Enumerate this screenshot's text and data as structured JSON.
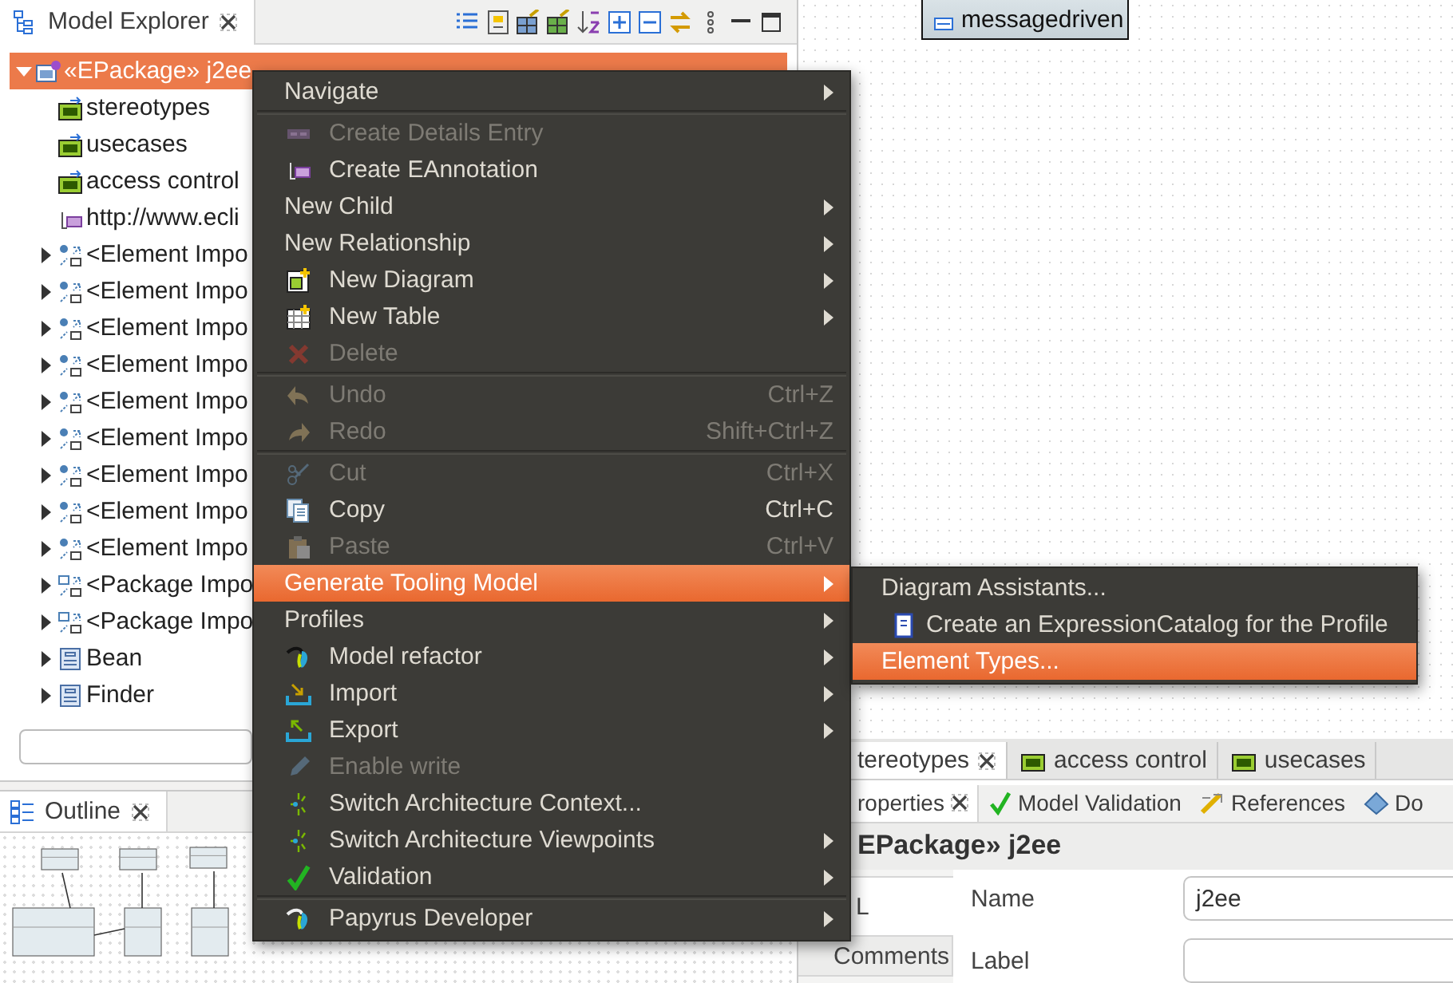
{
  "model_explorer": {
    "title": "Model Explorer",
    "tree": [
      {
        "label": "«EPackage» j2ee",
        "kind": "package",
        "expanded": true,
        "selected": true,
        "children": [
          {
            "label": "stereotypes",
            "kind": "profile",
            "selected": false
          },
          {
            "label": "usecases",
            "kind": "profile",
            "selected": false
          },
          {
            "label": "access control",
            "kind": "profile",
            "selected": false
          },
          {
            "label": "http://www.ecli",
            "kind": "annotation",
            "selected": false
          },
          {
            "label": "<Element Impo",
            "kind": "element-import",
            "expanded": false,
            "selected": false
          },
          {
            "label": "<Element Impo",
            "kind": "element-import",
            "expanded": false,
            "selected": false
          },
          {
            "label": "<Element Impo",
            "kind": "element-import",
            "expanded": false,
            "selected": false
          },
          {
            "label": "<Element Impo",
            "kind": "element-import",
            "expanded": false,
            "selected": false
          },
          {
            "label": "<Element Impo",
            "kind": "element-import",
            "expanded": false,
            "selected": false
          },
          {
            "label": "<Element Impo",
            "kind": "element-import",
            "expanded": false,
            "selected": false
          },
          {
            "label": "<Element Impo",
            "kind": "element-import",
            "expanded": false,
            "selected": false
          },
          {
            "label": "<Element Impo",
            "kind": "element-import",
            "expanded": false,
            "selected": false
          },
          {
            "label": "<Element Impo",
            "kind": "element-import",
            "expanded": false,
            "selected": false
          },
          {
            "label": "<Package Impo",
            "kind": "package-import",
            "expanded": false,
            "selected": false
          },
          {
            "label": "<Package Impo",
            "kind": "package-import",
            "expanded": false,
            "selected": false
          },
          {
            "label": "Bean",
            "kind": "stereotype",
            "expanded": false,
            "selected": false
          },
          {
            "label": "Finder",
            "kind": "stereotype",
            "expanded": false,
            "selected": false
          }
        ]
      }
    ]
  },
  "outline": {
    "title": "Outline"
  },
  "diagram": {
    "nodes": [
      {
        "label": "messagedriven"
      }
    ]
  },
  "context_menu": {
    "items": [
      {
        "kind": "item",
        "label": "Navigate",
        "submenu": true,
        "disabled": false,
        "selected": false
      },
      {
        "kind": "separator"
      },
      {
        "kind": "item",
        "label": "Create Details Entry",
        "submenu": false,
        "disabled": true,
        "selected": false
      },
      {
        "kind": "item",
        "label": "Create EAnnotation",
        "submenu": false,
        "disabled": false,
        "selected": false
      },
      {
        "kind": "item",
        "label": "New Child",
        "submenu": true,
        "disabled": false,
        "selected": false
      },
      {
        "kind": "item",
        "label": "New Relationship",
        "submenu": true,
        "disabled": false,
        "selected": false
      },
      {
        "kind": "item",
        "label": "New Diagram",
        "submenu": true,
        "disabled": false,
        "selected": false
      },
      {
        "kind": "item",
        "label": "New Table",
        "submenu": true,
        "disabled": false,
        "selected": false
      },
      {
        "kind": "item",
        "label": "Delete",
        "submenu": false,
        "disabled": true,
        "selected": false
      },
      {
        "kind": "separator"
      },
      {
        "kind": "item",
        "label": "Undo",
        "shortcut": "Ctrl+Z",
        "submenu": false,
        "disabled": true,
        "selected": false
      },
      {
        "kind": "item",
        "label": "Redo",
        "shortcut": "Shift+Ctrl+Z",
        "submenu": false,
        "disabled": true,
        "selected": false
      },
      {
        "kind": "separator"
      },
      {
        "kind": "item",
        "label": "Cut",
        "shortcut": "Ctrl+X",
        "submenu": false,
        "disabled": true,
        "selected": false
      },
      {
        "kind": "item",
        "label": "Copy",
        "shortcut": "Ctrl+C",
        "submenu": false,
        "disabled": false,
        "selected": false
      },
      {
        "kind": "item",
        "label": "Paste",
        "shortcut": "Ctrl+V",
        "submenu": false,
        "disabled": true,
        "selected": false
      },
      {
        "kind": "item",
        "label": "Generate Tooling Model",
        "submenu": true,
        "disabled": false,
        "selected": true
      },
      {
        "kind": "item",
        "label": "Profiles",
        "submenu": true,
        "disabled": false,
        "selected": false
      },
      {
        "kind": "item",
        "label": "Model refactor",
        "submenu": true,
        "disabled": false,
        "selected": false
      },
      {
        "kind": "item",
        "label": "Import",
        "submenu": true,
        "disabled": false,
        "selected": false
      },
      {
        "kind": "item",
        "label": "Export",
        "submenu": true,
        "disabled": false,
        "selected": false
      },
      {
        "kind": "item",
        "label": "Enable write",
        "submenu": false,
        "disabled": true,
        "selected": false
      },
      {
        "kind": "item",
        "label": "Switch Architecture Context...",
        "submenu": false,
        "disabled": false,
        "selected": false
      },
      {
        "kind": "item",
        "label": "Switch Architecture Viewpoints",
        "submenu": true,
        "disabled": false,
        "selected": false
      },
      {
        "kind": "item",
        "label": "Validation",
        "submenu": true,
        "disabled": false,
        "selected": false
      },
      {
        "kind": "separator"
      },
      {
        "kind": "item",
        "label": "Papyrus Developer",
        "submenu": true,
        "disabled": false,
        "selected": false
      }
    ]
  },
  "submenu": {
    "items": [
      {
        "label": "Diagram Assistants...",
        "selected": false
      },
      {
        "label": "Create an ExpressionCatalog for the Profile",
        "selected": false
      },
      {
        "label": "Element Types...",
        "selected": true
      }
    ]
  },
  "editor_tabs": [
    {
      "label": "tereotypes",
      "selected": true
    },
    {
      "label": "access control",
      "selected": false
    },
    {
      "label": "usecases",
      "selected": false
    }
  ],
  "properties": {
    "tabs": [
      {
        "label": "roperties",
        "selected": true
      },
      {
        "label": "Model Validation",
        "selected": false
      },
      {
        "label": "References",
        "selected": false
      },
      {
        "label": "Do",
        "selected": false
      }
    ],
    "title": "EPackage» j2ee",
    "sections": [
      {
        "label": "L",
        "selected": true
      },
      {
        "label": "Comments",
        "selected": false
      }
    ],
    "fields": [
      {
        "label": "Name",
        "value": "j2ee"
      },
      {
        "label": "Label"
      }
    ]
  }
}
